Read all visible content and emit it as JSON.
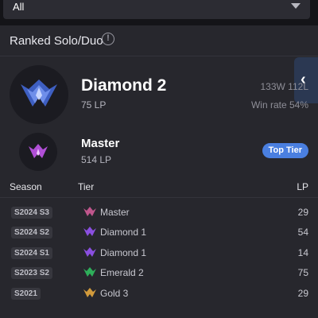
{
  "filter": {
    "selected": "All"
  },
  "ranked": {
    "title": "Ranked Solo/Duo",
    "current": {
      "tier": "Diamond 2",
      "lp": "75 LP",
      "record": "133W 112L",
      "win_rate": "Win rate 54%",
      "color": "#5b7de0"
    },
    "peak": {
      "tier": "Master",
      "lp": "514 LP",
      "badge": "Top Tier",
      "color": "#b04fd6"
    }
  },
  "seasons": {
    "headers": {
      "season": "Season",
      "tier": "Tier",
      "lp": "LP"
    },
    "rows": [
      {
        "season": "S2024 S3",
        "tier": "Master",
        "lp": "29",
        "color": "#c0568c"
      },
      {
        "season": "S2024 S2",
        "tier": "Diamond 1",
        "lp": "54",
        "color": "#8a4fe0"
      },
      {
        "season": "S2024 S1",
        "tier": "Diamond 1",
        "lp": "14",
        "color": "#8a4fe0"
      },
      {
        "season": "S2023 S2",
        "tier": "Emerald 2",
        "lp": "75",
        "color": "#2eaf5a"
      },
      {
        "season": "S2021",
        "tier": "Gold 3",
        "lp": "29",
        "color": "#d19a3c"
      }
    ]
  }
}
